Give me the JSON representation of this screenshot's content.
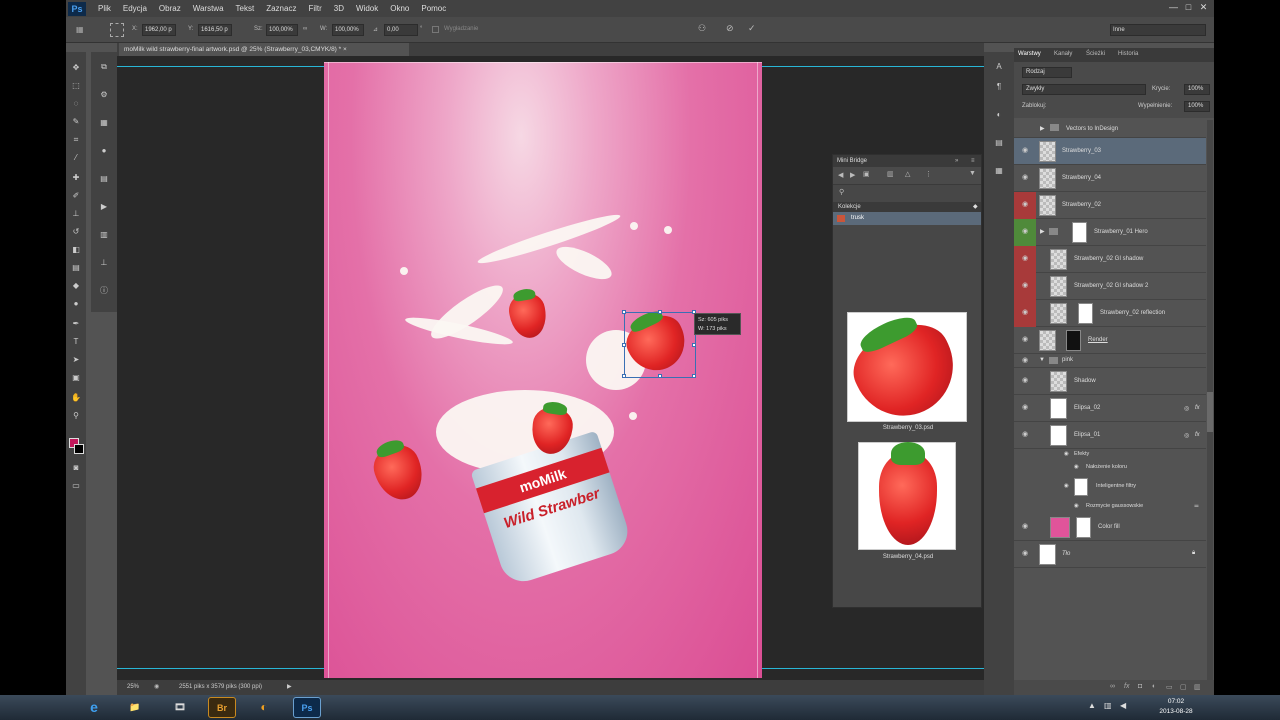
{
  "menubar": {
    "logo": "Ps",
    "items": [
      "Plik",
      "Edycja",
      "Obraz",
      "Warstwa",
      "Tekst",
      "Zaznacz",
      "Filtr",
      "3D",
      "Widok",
      "Okno",
      "Pomoc"
    ],
    "win_min": "—",
    "win_max": "□",
    "win_close": "✕"
  },
  "options": {
    "x_label": "X:",
    "x_value": "1962,00 p",
    "y_label": "Y:",
    "y_value": "1616,50 p",
    "w_label": "Sz:",
    "w_value": "100,00%",
    "link": "∞",
    "h_label": "W:",
    "h_value": "100,00%",
    "angle_label": "⊿",
    "angle_value": "0,00",
    "interp": "°",
    "smooth": "Wygładzanie",
    "workspace": "Inne"
  },
  "document": {
    "tab_title": "moMilk wild strawberry-final artwork.psd @ 25% (Strawberry_03,CMYK/8) *",
    "tab_close": "×",
    "cup_brand": "moMilk",
    "cup_text": "Wild Strawber",
    "tooltip_w": "Sz: 605 piks",
    "tooltip_h": "W: 173 piks"
  },
  "status": {
    "zoom": "25%",
    "info": "2551 piks x 3579 piks (300 ppi)",
    "arrow": "▶"
  },
  "minibridge": {
    "title": "Mini Bridge",
    "kolekcje": "Kolekcje",
    "folder": "trusk",
    "thumb1_caption": "Strawberry_03.psd",
    "thumb2_caption": "Strawberry_04.psd"
  },
  "layers": {
    "tabs": [
      "Warstwy",
      "Kanały",
      "Ścieżki",
      "Historia"
    ],
    "kind_label": "Rodzaj",
    "blend_mode": "Zwykły",
    "opacity_label": "Krycie:",
    "opacity_value": "100%",
    "lock_label": "Zablokuj:",
    "fill_label": "Wypełnienie:",
    "fill_value": "100%",
    "rows": [
      {
        "name": "Vectors to InDesign",
        "type": "group"
      },
      {
        "name": "Strawberry_03",
        "type": "layer"
      },
      {
        "name": "Strawberry_04",
        "type": "layer"
      },
      {
        "name": "Strawberry_02",
        "type": "layer"
      },
      {
        "name": "Strawberry_01 Hero",
        "type": "group"
      },
      {
        "name": "Strawberry_02 GI shadow",
        "type": "layer"
      },
      {
        "name": "Strawberry_02 GI shadow 2",
        "type": "layer"
      },
      {
        "name": "Strawberry_02 reflection",
        "type": "layer"
      },
      {
        "name": "Render",
        "type": "layer"
      },
      {
        "name": "pink",
        "type": "group"
      },
      {
        "name": "Shadow",
        "type": "layer"
      },
      {
        "name": "Elipsa_02",
        "type": "layer"
      },
      {
        "name": "Elipsa_01",
        "type": "layer"
      },
      {
        "name": "Efekty",
        "type": "effect"
      },
      {
        "name": "Nałożenie koloru",
        "type": "effect"
      },
      {
        "name": "Inteligentne filtry",
        "type": "effect"
      },
      {
        "name": "Rozmycie gaussowskie",
        "type": "effect"
      },
      {
        "name": "Color fill",
        "type": "layer"
      },
      {
        "name": "Tło",
        "type": "layer"
      }
    ]
  },
  "taskbar": {
    "time": "07:02",
    "date": "2013-08-28",
    "apps": [
      "e",
      "📁",
      "🎞",
      "Br",
      "◐",
      "Ps"
    ]
  },
  "colors": {
    "accent": "#29b6d6",
    "selected_row": "#5b6a7a",
    "visibility_red": "#a83a3a",
    "visibility_green": "#4f8a3a",
    "foreground": "#c2185b",
    "background": "#000000"
  }
}
